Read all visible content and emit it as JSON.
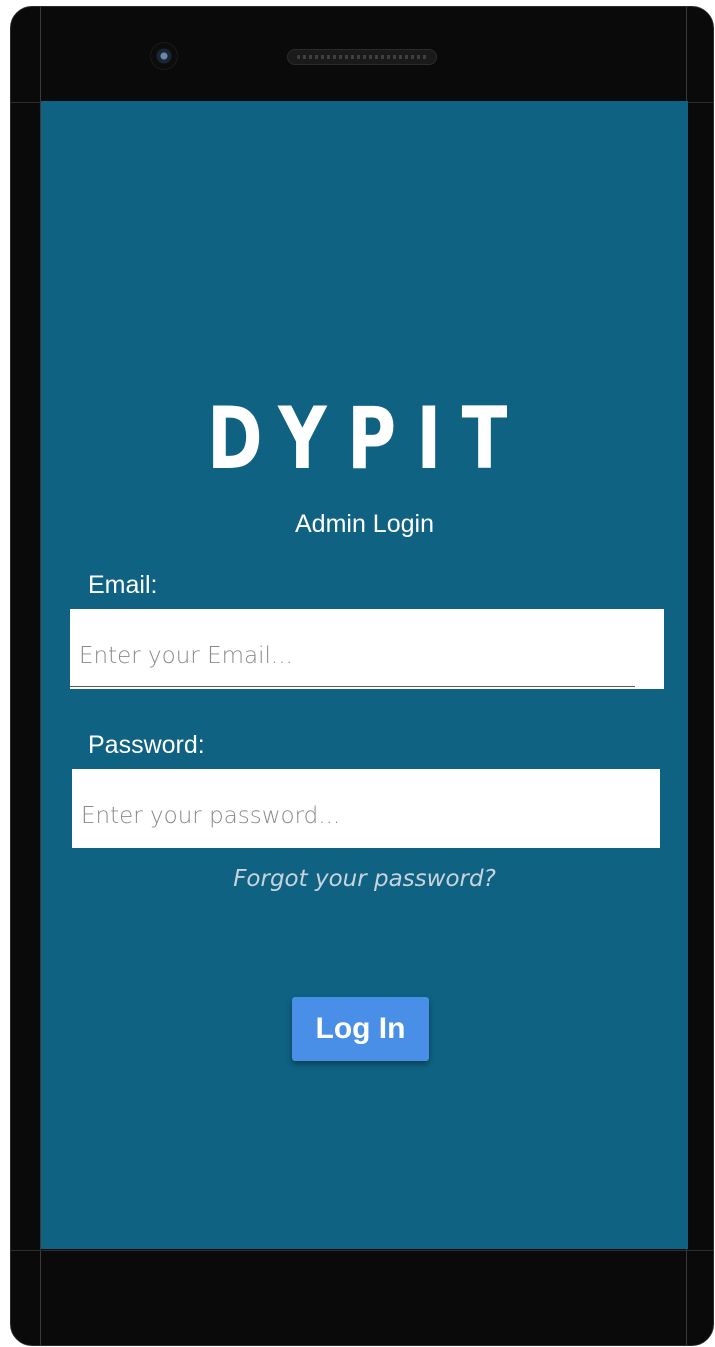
{
  "app": {
    "logo_text": "DYPIT",
    "subtitle": "Admin Login"
  },
  "form": {
    "email_label": "Email:",
    "email_placeholder": "Enter your Email...",
    "email_value": "",
    "password_label": "Password:",
    "password_placeholder": "Enter your password...",
    "password_value": "",
    "forgot_link": "Forgot your password?",
    "login_button": "Log In"
  },
  "colors": {
    "screen_background": "#0f6282",
    "phone_frame": "#0a0a0a",
    "button_background": "#4a8fe7",
    "input_background": "#ffffff",
    "text_on_screen": "#ffffff"
  },
  "icons": {
    "camera": "front-camera-icon",
    "speaker": "earpiece-speaker-icon"
  }
}
